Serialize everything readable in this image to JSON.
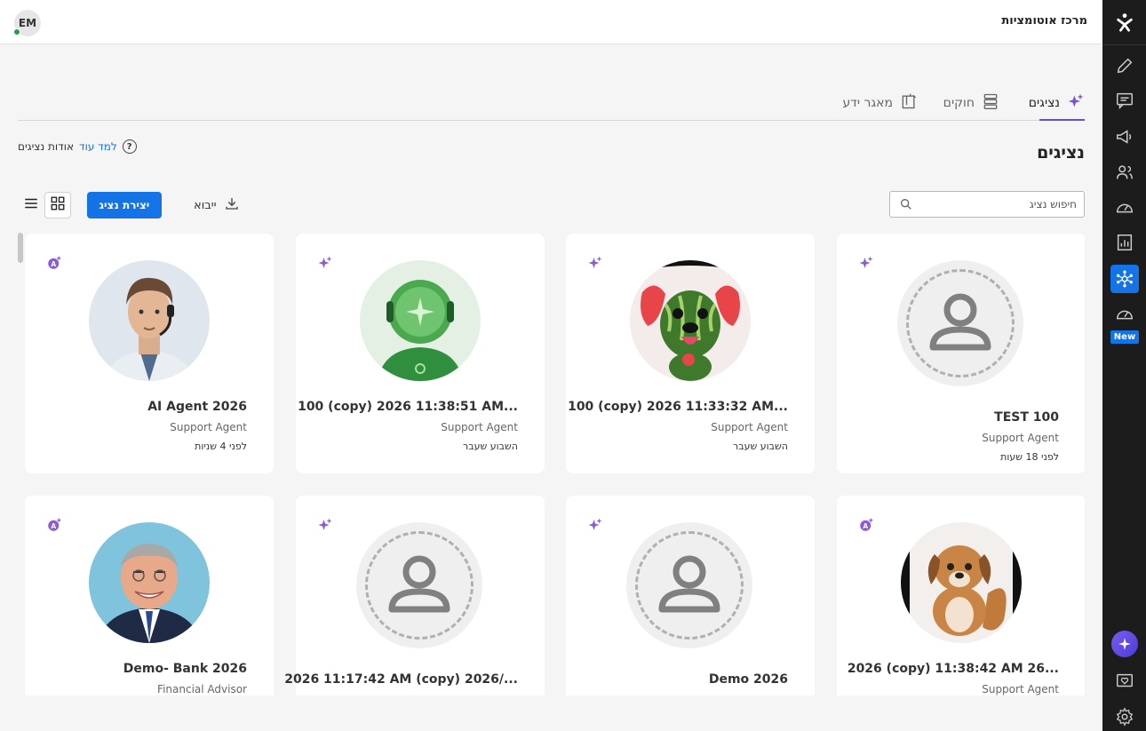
{
  "header": {
    "title": "מרכז אוטומציות",
    "user_initials": "EM"
  },
  "rail": {
    "new_badge": "New"
  },
  "tabs": [
    {
      "label": "נציגים",
      "icon": "sparkle-icon",
      "active": true
    },
    {
      "label": "חוקים",
      "icon": "rules-icon",
      "active": false
    },
    {
      "label": "מאגר ידע",
      "icon": "knowledge-base-icon",
      "active": false
    }
  ],
  "page": {
    "title": "נציגים",
    "learn_link": "למד עוד",
    "learn_text": "אודות נציגים"
  },
  "toolbar": {
    "search_placeholder": "חיפוש נציג",
    "import_label": "ייבוא",
    "create_label": "יצירת נציג"
  },
  "cards": [
    {
      "name": "TEST 100",
      "role": "Support Agent",
      "time": "לפני 18 שעות",
      "badge": "sparkle-icon",
      "avatar": "placeholder"
    },
    {
      "name": "100 (copy) 2026 11:33:32 AM...",
      "role": "Support Agent",
      "time": "השבוע שעבר",
      "badge": "sparkle-icon",
      "avatar": "watermelon-dog"
    },
    {
      "name": "100 (copy) 2026 11:38:51 AM...",
      "role": "Support Agent",
      "time": "השבוע שעבר",
      "badge": "sparkle-icon",
      "avatar": "green-robot"
    },
    {
      "name": "AI Agent 2026",
      "role": "Support Agent",
      "time": "לפני 4 שניות",
      "badge": "ai-badge-icon",
      "avatar": "man-headset"
    },
    {
      "name": "2026 (copy) 11:38:42 AM 26...",
      "role": "Support Agent",
      "time": "",
      "badge": "ai-badge-icon",
      "avatar": "puppy"
    },
    {
      "name": "Demo 2026",
      "role": "",
      "time": "",
      "badge": "sparkle-icon",
      "avatar": "placeholder"
    },
    {
      "name": "2026 11:17:42 AM (copy) 2026/...",
      "role": "",
      "time": "",
      "badge": "sparkle-icon",
      "avatar": "placeholder"
    },
    {
      "name": "Demo- Bank 2026",
      "role": "Financial Advisor",
      "time": "",
      "badge": "ai-badge-icon",
      "avatar": "businessman"
    }
  ]
}
